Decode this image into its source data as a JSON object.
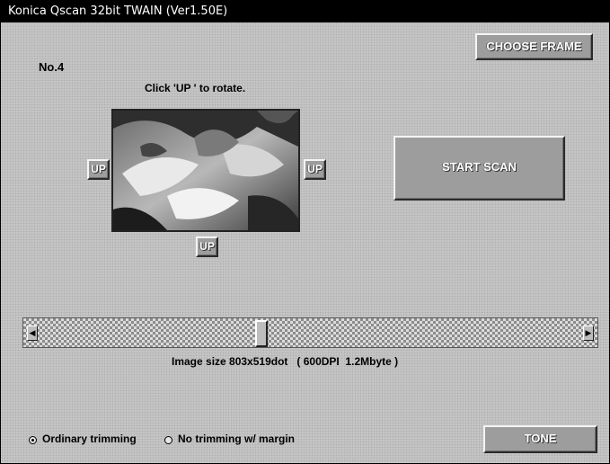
{
  "window": {
    "title": "Konica Qscan 32bit TWAIN (Ver1.50E)"
  },
  "header": {
    "frame_number": "No.4",
    "instruction": "Click 'UP ' to rotate."
  },
  "buttons": {
    "choose_frame": "CHOOSE FRAME",
    "start_scan": "START SCAN",
    "up": "UP",
    "tone": "TONE"
  },
  "image_info": "Image size 803x519dot   ( 600DPI  1.2Mbyte )",
  "trimming": {
    "options": [
      "Ordinary trimming",
      "No trimming w/ margin"
    ],
    "selected": "Ordinary trimming"
  },
  "icons": {
    "scroll_left": "triangle-left-icon",
    "scroll_right": "triangle-right-icon"
  }
}
